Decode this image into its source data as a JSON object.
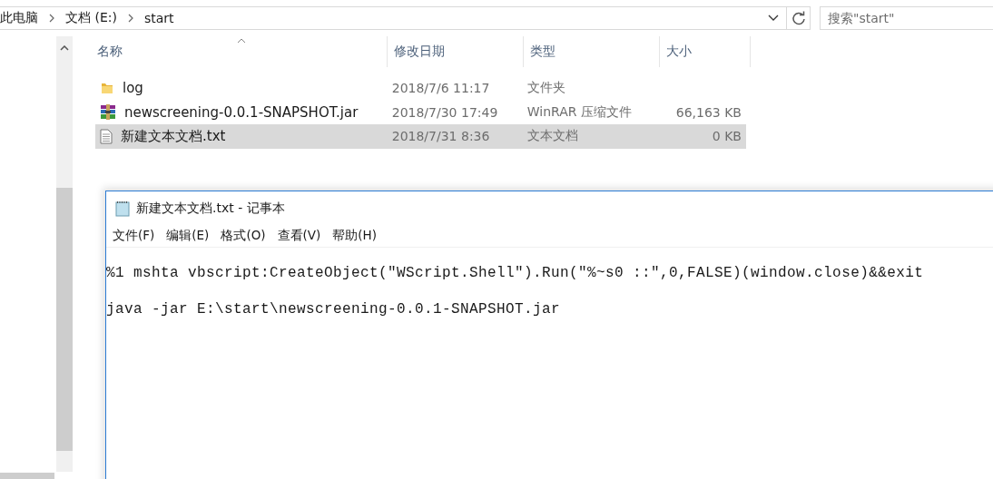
{
  "explorer": {
    "breadcrumb": [
      {
        "label": "此电脑"
      },
      {
        "label": "文档 (E:)"
      },
      {
        "label": "start"
      }
    ],
    "search": {
      "placeholder": "搜索\"start\""
    },
    "columns": [
      {
        "label": "名称",
        "sorted": true
      },
      {
        "label": "修改日期",
        "sorted": false
      },
      {
        "label": "类型",
        "sorted": false
      },
      {
        "label": "大小",
        "sorted": false
      }
    ],
    "rows": [
      {
        "kind": "folder",
        "name": "log",
        "date": "2018/7/6 11:17",
        "type": "文件夹",
        "size": "",
        "selected": false
      },
      {
        "kind": "archive",
        "name": "newscreening-0.0.1-SNAPSHOT.jar",
        "date": "2018/7/30 17:49",
        "type": "WinRAR 压缩文件",
        "size": "66,163 KB",
        "selected": false
      },
      {
        "kind": "text",
        "name": "新建文本文档.txt",
        "date": "2018/7/31 8:36",
        "type": "文本文档",
        "size": "0 KB",
        "selected": true
      }
    ]
  },
  "notepad": {
    "title": "新建文本文档.txt - 记事本",
    "menu": [
      "文件(F)",
      "编辑(E)",
      "格式(O)",
      "查看(V)",
      "帮助(H)"
    ],
    "lines": [
      "%1 mshta vbscript:CreateObject(\"WScript.Shell\").Run(\"%~s0 ::\",0,FALSE)(window.close)&&exit",
      "java -jar E:\\start\\newscreening-0.0.1-SNAPSHOT.jar"
    ]
  }
}
